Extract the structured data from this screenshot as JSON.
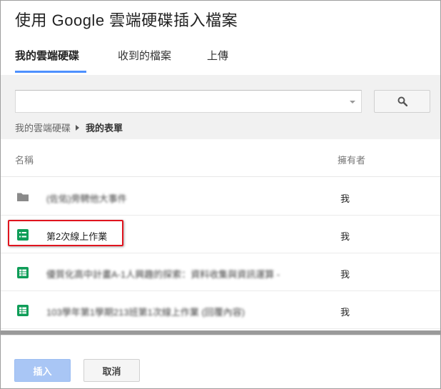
{
  "dialog": {
    "title": "使用 Google 雲端硬碟插入檔案"
  },
  "tabs": [
    {
      "label": "我的雲端硬碟",
      "active": true
    },
    {
      "label": "收到的檔案",
      "active": false
    },
    {
      "label": "上傳",
      "active": false
    }
  ],
  "search": {
    "value": "",
    "placeholder": ""
  },
  "breadcrumb": {
    "root": "我的雲端硬碟",
    "current": "我的表單"
  },
  "list": {
    "headers": {
      "name": "名稱",
      "owner": "擁有者"
    },
    "rows": [
      {
        "icon": "folder-icon",
        "name": "(佐佑)旁騁他大事件",
        "owner": "我",
        "blurred": true
      },
      {
        "icon": "form-icon",
        "name": "第2次線上作業",
        "owner": "我",
        "blurred": false
      },
      {
        "icon": "spreadsheet-icon",
        "name": "優質化高中計畫A-1人興趣的探索：資料收集與資訊運算 -",
        "owner": "我",
        "blurred": true
      },
      {
        "icon": "spreadsheet-icon",
        "name": "103學年第1學期213班第1次線上作業 (回覆內容)",
        "owner": "我",
        "blurred": true
      }
    ]
  },
  "footer": {
    "insert_label": "插入",
    "cancel_label": "取消"
  },
  "colors": {
    "accent": "#4d90fe",
    "form_green": "#0f9d58",
    "sheet_green": "#0f9d58",
    "highlight": "#e0141e"
  }
}
